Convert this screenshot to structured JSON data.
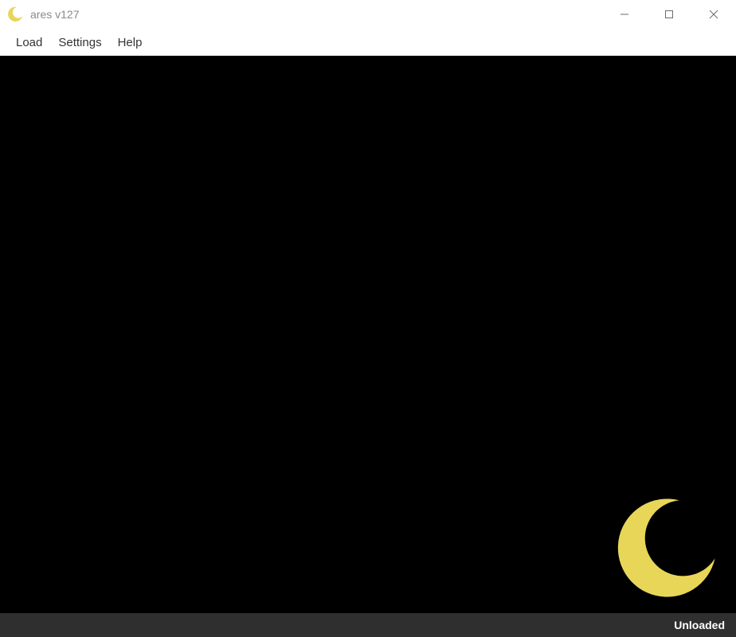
{
  "titlebar": {
    "title": "ares v127"
  },
  "menubar": {
    "items": [
      {
        "label": "Load"
      },
      {
        "label": "Settings"
      },
      {
        "label": "Help"
      }
    ]
  },
  "statusbar": {
    "status": "Unloaded"
  },
  "colors": {
    "moon": "#e8d659",
    "viewport_bg": "#000000",
    "statusbar_bg": "#2f2f2f"
  }
}
